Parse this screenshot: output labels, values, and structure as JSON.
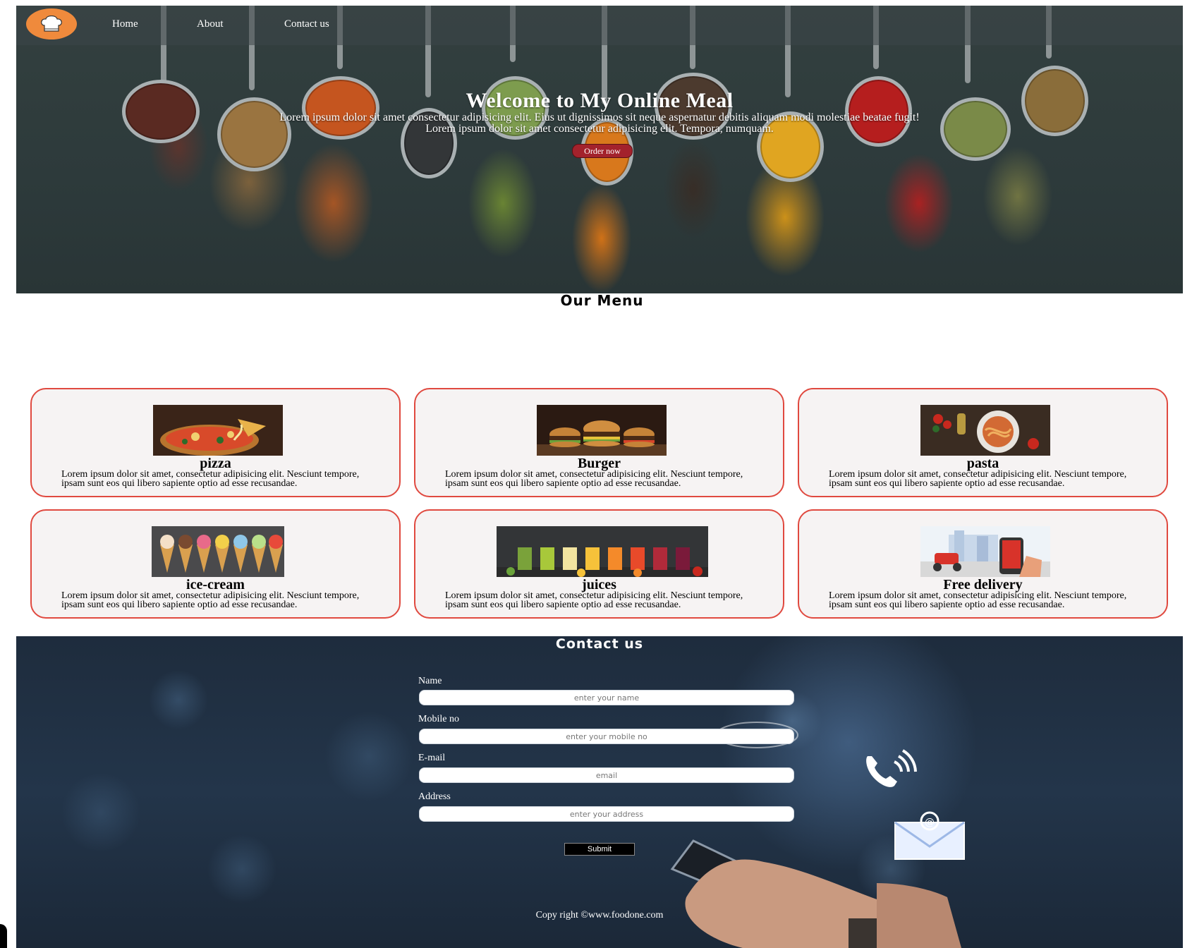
{
  "nav": {
    "links": [
      "Home",
      "About",
      "Contact us"
    ],
    "logo": "chef-hat-icon"
  },
  "hero": {
    "title": "Welcome to My Online Meal",
    "line1": "Lorem ipsum dolor sit amet consectetur adipisicing elit. Eius ut dignissimos sit neque aspernatur debitis aliquam modi molestiae beatae fugit!",
    "line2": "Lorem ipsum dolor sit amet consectetur adipisicing elit. Tempora, numquam.",
    "button": "Order now"
  },
  "menu": {
    "heading": "Our Menu",
    "description": "Lorem ipsum dolor sit amet, consectetur adipisicing elit. Nesciunt tempore, ipsam sunt eos qui libero sapiente optio ad esse recusandae.",
    "items": [
      {
        "title": "pizza"
      },
      {
        "title": "Burger"
      },
      {
        "title": "pasta"
      },
      {
        "title": "ice-cream"
      },
      {
        "title": "juices"
      },
      {
        "title": "Free delivery"
      }
    ]
  },
  "contact": {
    "heading": "Contact us",
    "fields": [
      {
        "label": "Name",
        "placeholder": "enter your name"
      },
      {
        "label": "Mobile no",
        "placeholder": "enter your mobile no"
      },
      {
        "label": "E-mail",
        "placeholder": "email"
      },
      {
        "label": "Address",
        "placeholder": "enter your address"
      }
    ],
    "submit": "Submit",
    "copyright": "Copy right ©www.foodone.com"
  },
  "colors": {
    "card_border": "#e0493f",
    "card_bg": "#f6f3f3",
    "order_button": "#a3222c",
    "logo": "#ef8a3c"
  }
}
